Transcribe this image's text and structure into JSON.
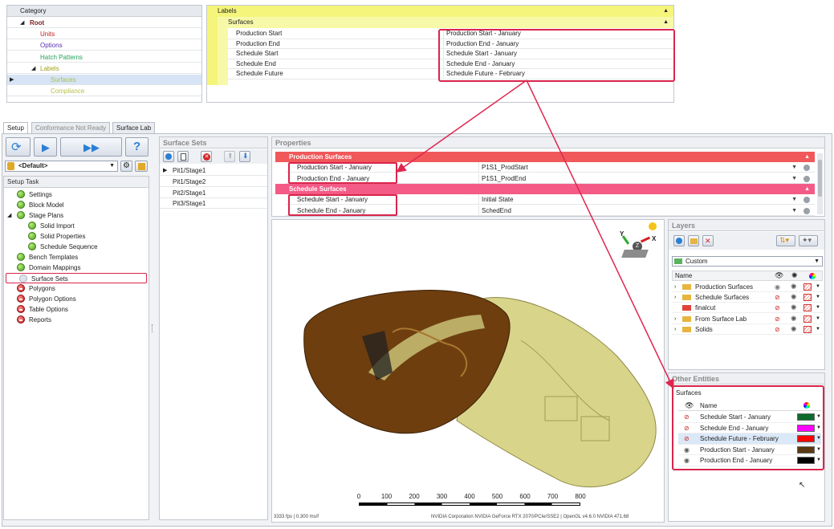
{
  "category_tree": {
    "header": "Category",
    "items": [
      {
        "label": "Root",
        "level": 0,
        "color": "#7a1d1d",
        "bold": true
      },
      {
        "label": "Units",
        "level": 1,
        "color": "#c02020"
      },
      {
        "label": "Options",
        "level": 1,
        "color": "#5a2fb0"
      },
      {
        "label": "Hatch Patterns",
        "level": 1,
        "color": "#23a35a"
      },
      {
        "label": "Labels",
        "level": 1,
        "color": "#a3a01d"
      },
      {
        "label": "Surfaces",
        "level": 2,
        "color": "#a9c04a"
      },
      {
        "label": "Compliance",
        "level": 2,
        "color": "#b8c04a"
      }
    ]
  },
  "labels_grid": {
    "header": "Labels",
    "group": "Surfaces",
    "rows": [
      {
        "name": "Production Start",
        "value": "Production Start - January"
      },
      {
        "name": "Production End",
        "value": "Production End - January"
      },
      {
        "name": "Schedule Start",
        "value": "Schedule Start - January"
      },
      {
        "name": "Schedule End",
        "value": "Schedule End - January"
      },
      {
        "name": "Schedule Future",
        "value": "Schedule Future - February"
      }
    ]
  },
  "tabs": [
    "Setup",
    "Conformance Not Ready",
    "Surface Lab"
  ],
  "default_dropdown": "<Default>",
  "setup_task": {
    "header": "Setup Task",
    "items": [
      {
        "label": "Settings",
        "status": "ok",
        "level": 1
      },
      {
        "label": "Block Model",
        "status": "ok",
        "level": 1
      },
      {
        "label": "Stage Plans",
        "status": "ok",
        "level": 1
      },
      {
        "label": "Solid Import",
        "status": "ok",
        "level": 2
      },
      {
        "label": "Solid Properties",
        "status": "ok",
        "level": 2
      },
      {
        "label": "Schedule Sequence",
        "status": "ok",
        "level": 2
      },
      {
        "label": "Bench Templates",
        "status": "ok",
        "level": 1
      },
      {
        "label": "Domain Mappings",
        "status": "ok",
        "level": 1
      },
      {
        "label": "Surface Sets",
        "status": "pending",
        "level": 1
      },
      {
        "label": "Polygons",
        "status": "error",
        "level": 1
      },
      {
        "label": "Polygon Options",
        "status": "error",
        "level": 1
      },
      {
        "label": "Table Options",
        "status": "error",
        "level": 1
      },
      {
        "label": "Reports",
        "status": "error",
        "level": 1
      }
    ]
  },
  "surface_sets": {
    "header": "Surface Sets",
    "items": [
      "Pit1/Stage1",
      "Pit1/Stage2",
      "Pit2/Stage1",
      "Pit3/Stage1"
    ]
  },
  "properties": {
    "header": "Properties",
    "groups": [
      {
        "name": "Production Surfaces",
        "rows": [
          {
            "name": "Production Start - January",
            "value": "P1S1_ProdStart"
          },
          {
            "name": "Production End - January",
            "value": "P1S1_ProdEnd"
          }
        ]
      },
      {
        "name": "Schedule Surfaces",
        "rows": [
          {
            "name": "Schedule Start - January",
            "value": "Initial State"
          },
          {
            "name": "Schedule End - January",
            "value": "SchedEnd"
          }
        ]
      }
    ]
  },
  "layers": {
    "header": "Layers",
    "dropdown": "Custom",
    "col_name": "Name",
    "items": [
      "Production Surfaces",
      "Schedule Surfaces",
      "finalcut",
      "From Surface Lab",
      "Solids"
    ]
  },
  "other_entities": {
    "header": "Other Entities",
    "group": "Surfaces",
    "col_name": "Name",
    "rows": [
      {
        "name": "Schedule Start - January",
        "color": "#0b6b2b",
        "visible": false
      },
      {
        "name": "Schedule End - January",
        "color": "#ff00ff",
        "visible": false
      },
      {
        "name": "Schedule Future - February",
        "color": "#ff0000",
        "visible": false
      },
      {
        "name": "Production Start - January",
        "color": "#5a3a12",
        "visible": true
      },
      {
        "name": "Production End - January",
        "color": "#000000",
        "visible": true
      }
    ]
  },
  "scale_bar": {
    "ticks": [
      "0",
      "100",
      "200",
      "300",
      "400",
      "500",
      "600",
      "700",
      "800"
    ]
  },
  "gizmo": {
    "x": "X",
    "y": "Y",
    "z": "Z"
  },
  "status": {
    "fps": "3333 fps | 0.300 ms/f",
    "gpu": "NVIDIA Corporation NVIDIA GeForce RTX 2070/PCIe/SSE2 | OpenGL v4.6.0 NVIDIA 471.68"
  }
}
